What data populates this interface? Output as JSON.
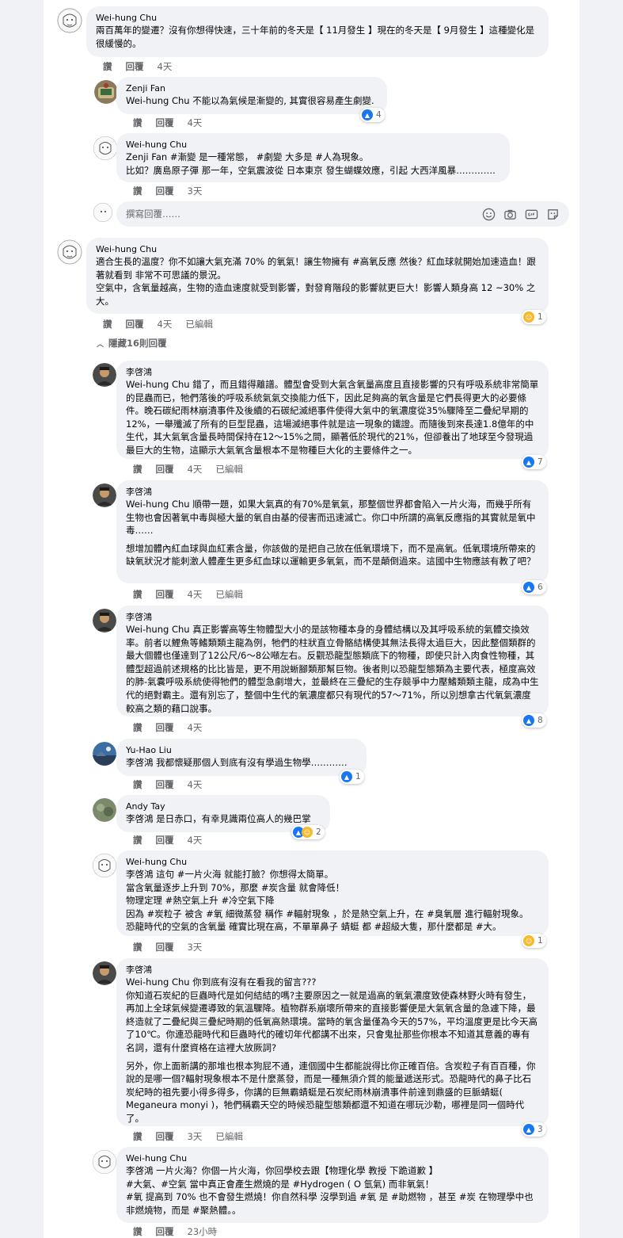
{
  "reply_placeholder": "撰寫回覆……",
  "actions": {
    "like": "讚",
    "reply": "回覆",
    "edited": "已編輯"
  },
  "hide_replies": "隱藏16則回覆",
  "comments": [
    {
      "author": "Wei-hung Chu",
      "lines": [
        "兩百萬年的變遷？沒有你想得快速，三十年前的冬天是【 11月發生 】現在的冬天是【 9月發生 】這種變化是很緩慢的。"
      ],
      "time": "4天"
    },
    {
      "author": "Zenji Fan",
      "lines": [
        "Wei-hung Chu 不能以為氣候是漸變的, 其實很容易產生劇變."
      ],
      "time": "4天",
      "reaction_count": "4"
    },
    {
      "author": "Wei-hung Chu",
      "lines": [
        "Zenji Fan #漸變 是一種常態， #劇變 大多是 #人為現象。",
        "比如？廣島原子彈 那一年，空氣震波從 日本東京 發生蝴蝶效應，引起 大西洋風暴…………."
      ],
      "time": "3天"
    },
    {
      "author": "Wei-hung Chu",
      "lines": [
        "適合生長的溫度？你不如讓大氣充滿 70% 的氧氣！讓生物擁有 #高氧反應 然後？紅血球就開始加速造血！跟著就看到 非常不可思議的景況。",
        "空氣中，含氧量越高，生物的造血速度就受到影響，對發育階段的影響就更巨大！影響人類身高 12 ~30% 之大。"
      ],
      "time": "4天",
      "edited": true,
      "reaction_count": "1"
    },
    {
      "author": "李啓鴻",
      "lines": [
        "Wei-hung Chu 錯了，而且錯得離譜。體型會受到大氣含氧量高度且直接影響的只有呼吸系統非常簡單的昆蟲而已，牠們落後的呼吸系統氣氣交換能力低下，因此足夠高的氧含量是它們長得更大的必要條件。晚石碳紀雨林崩潰事件及後續的石碳紀滅絕事件使得大氣中的氧濃度從35%驟降至二疊紀早期的12%，一舉殲滅了所有的巨型昆蟲，這場滅絕事件就是這一現象的鐵證。而隨後到來長達1.8億年的中生代，其大氣氧含量長時間保持在12～15%之間，顯著低於現代的21%，但卻養出了地球至今發現過最巨大的生物，這顯示大氣氧含量根本不是物種巨大化的主要條件之一。"
      ],
      "time": "4天",
      "edited": true,
      "reaction_count": "7"
    },
    {
      "author": "李啓鴻",
      "lines": [
        "Wei-hung Chu 順帶一題，如果大氣真的有70%是氧氣，那整個世界都會陷入一片火海，而幾乎所有生物也會因著氧中毒與極大量的氧自由基的侵害而迅速滅亡。你口中所謂的高氧反應指的其實就是氧中毒……",
        "想增加體內紅血球與血紅素含量，你該做的是把自己放在低氧環境下，而不是高氧。低氧環境所帶來的缺氧狀況才能刺激人體產生更多紅血球以運輸更多氧氣，而不是顛倒過來。這國中生物應該有教了吧？"
      ],
      "time": "4天",
      "edited": true,
      "reaction_count": "6"
    },
    {
      "author": "李啓鴻",
      "lines": [
        "Wei-hung Chu 真正影響高等生物體型大小的是該物種本身的身體結構以及其呼吸系統的氣體交換效率。前者以鯉魚等鰭類類主龍為例，牠們的柱狀直立骨骼結構使其無法長得太過巨大，因此整個類群的最大個體也僅達到了12公尺/6～8公噸左右。反觀恐龍型態類底下的物種，即使只計入肉食性物種，其體型超過前述規格的比比皆是，更不用說蜥腳類那幫巨物。後者則以恐龍型態類為主要代表，極度高效的肺-氣囊呼吸系統使得牠們的體型急劇增大，並最終在三疊紀的生存競爭中力壓鰭類類主龍，成為中生代的絕對霸主。還有別忘了，整個中生代的氧濃度都只有現代的57～71%，所以別想拿古代氧氣濃度較高之類的藉口說事。"
      ],
      "time": "4天",
      "reaction_count": "8"
    },
    {
      "author": "Yu-Hao Liu",
      "lines": [
        "李啓鴻 我都懷疑那個人到底有沒有學過生物學…………"
      ],
      "time": "4天",
      "reaction_count": "1"
    },
    {
      "author": "Andy Tay",
      "lines": [
        "李啓鴻 是日赤口，有幸見識兩位高人的幾巴掌"
      ],
      "time": "4天",
      "reaction_count": "2"
    },
    {
      "author": "Wei-hung Chu",
      "lines": [
        "李啓鴻 這句 #一片火海 就能打臉？你想得太簡單。",
        "當含氧量逐步上升到 70%，那麼 #炭含量 就會降低！",
        "物理定理 #熱空氣上升 #冷空氣下降",
        "因為 #炭粒子 被含 #氧 細微蒸發 稱作 #輻射現象 ，於是熱空氣上升，在 #臭氧層 進行輻射現象。",
        "恐龍時代的空氣的含氧量 確實比現在高，不單單鼻子 蜻蜓 都 #超級大隻，那什麼都是 #大。"
      ],
      "time": "3天",
      "reaction_count": "1"
    },
    {
      "author": "李啓鴻",
      "lines": [
        "Wei-hung Chu 你到底有沒有在看我的留言???",
        "你知道石炭紀的巨蟲時代是如何結結的嗎?主要原因之一就是過高的氧氣濃度致使森林野火時有發生，再加上全球氣候變遷導致的氣溫驟降。植物群系崩壞所帶來的直接影響便是大氣氧含量的急遽下降，最終造就了二疊紀與三疊紀時期的低氧高熱環境。當時的氧含量僅為今天的57%，平均溫度更是比今天高了10℃。你連恐龍時代和巨蟲時代的確切年代都講不出來，只會鬼扯那些你根本不知道其意義的專有名詞，還有什麼資格在這裡大放厥詞?",
        "另外，你上面新講的那堆也根本狗屁不通，連個國中生都能說得比你正確百倍。含炭粒子有百百種，你說的是哪一個?輻射現象根本不是什麼蒸發，而是一種無須介質的能量遞送形式。恐龍時代的鼻子比石炭紀時的祖先要小得多得多，你講的巨無霸蜻蜓是石炭紀雨林崩潰事件前達到鼎盛的巨脈蜻蜓( Meganeura monyi )，牠們稱霸天空的時候恐龍型態類都還不知道在哪玩沙勒，哪裡是同一個時代了。"
      ],
      "time": "3天",
      "edited": true,
      "reaction_count": "3"
    },
    {
      "author": "Wei-hung Chu",
      "lines": [
        "李啓鴻 一片火海？你個一片火海，你回學校去跟【物理化學 教授 下跪道歉 】",
        "#大氣、#空氣 當中真正會產生燃燒的是 #Hydrogen ( O 氫氣) 而非氧氣！",
        "#氧 提高到 70% 也不會發生燃燒！你自然科學 沒學到過 #氧 是 #助燃物 ，甚至 #炭 在物理學中也非燃燒物，而是 #聚熱體。。"
      ],
      "time": "23小時"
    }
  ],
  "icons": {
    "emoji": "smiley-icon",
    "camera": "camera-icon",
    "gif": "gif-icon",
    "sticker": "sticker-icon",
    "like": "thumbs-up-icon",
    "haha": "haha-icon",
    "chevron": "chevron-up-icon"
  },
  "colors": {
    "like": "#1877f2",
    "haha": "#f7b928",
    "bubble": "#f0f2f5",
    "meta": "#65676b"
  }
}
